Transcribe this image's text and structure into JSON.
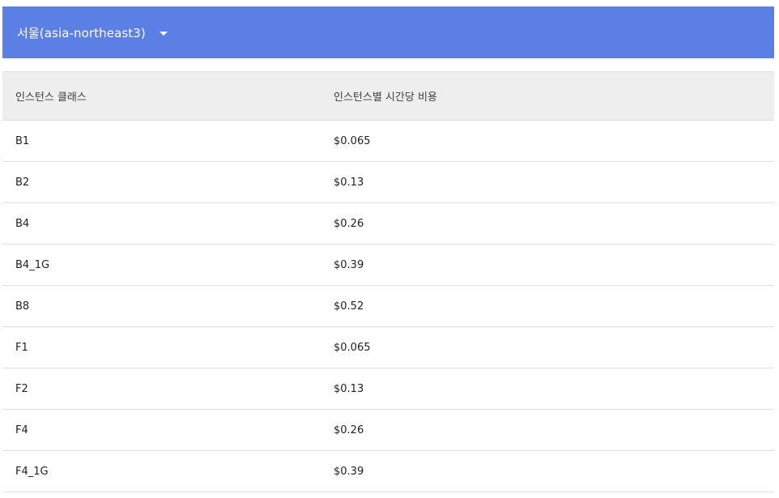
{
  "region_selector": {
    "label": "서울(asia-northeast3)",
    "icon": "arrow-drop-down-icon"
  },
  "table": {
    "columns": [
      "인스턴스 클래스",
      "인스턴스별 시간당 비용"
    ],
    "rows": [
      {
        "instance_class": "B1",
        "hourly_cost": "$0.065"
      },
      {
        "instance_class": "B2",
        "hourly_cost": "$0.13"
      },
      {
        "instance_class": "B4",
        "hourly_cost": "$0.26"
      },
      {
        "instance_class": "B4_1G",
        "hourly_cost": "$0.39"
      },
      {
        "instance_class": "B8",
        "hourly_cost": "$0.52"
      },
      {
        "instance_class": "F1",
        "hourly_cost": "$0.065"
      },
      {
        "instance_class": "F2",
        "hourly_cost": "$0.13"
      },
      {
        "instance_class": "F4",
        "hourly_cost": "$0.26"
      },
      {
        "instance_class": "F4_1G",
        "hourly_cost": "$0.39"
      }
    ]
  },
  "colors": {
    "header_bar": "#5b7fe4",
    "table_header_bg": "#eeeeee",
    "row_divider": "#e0e0e0"
  }
}
